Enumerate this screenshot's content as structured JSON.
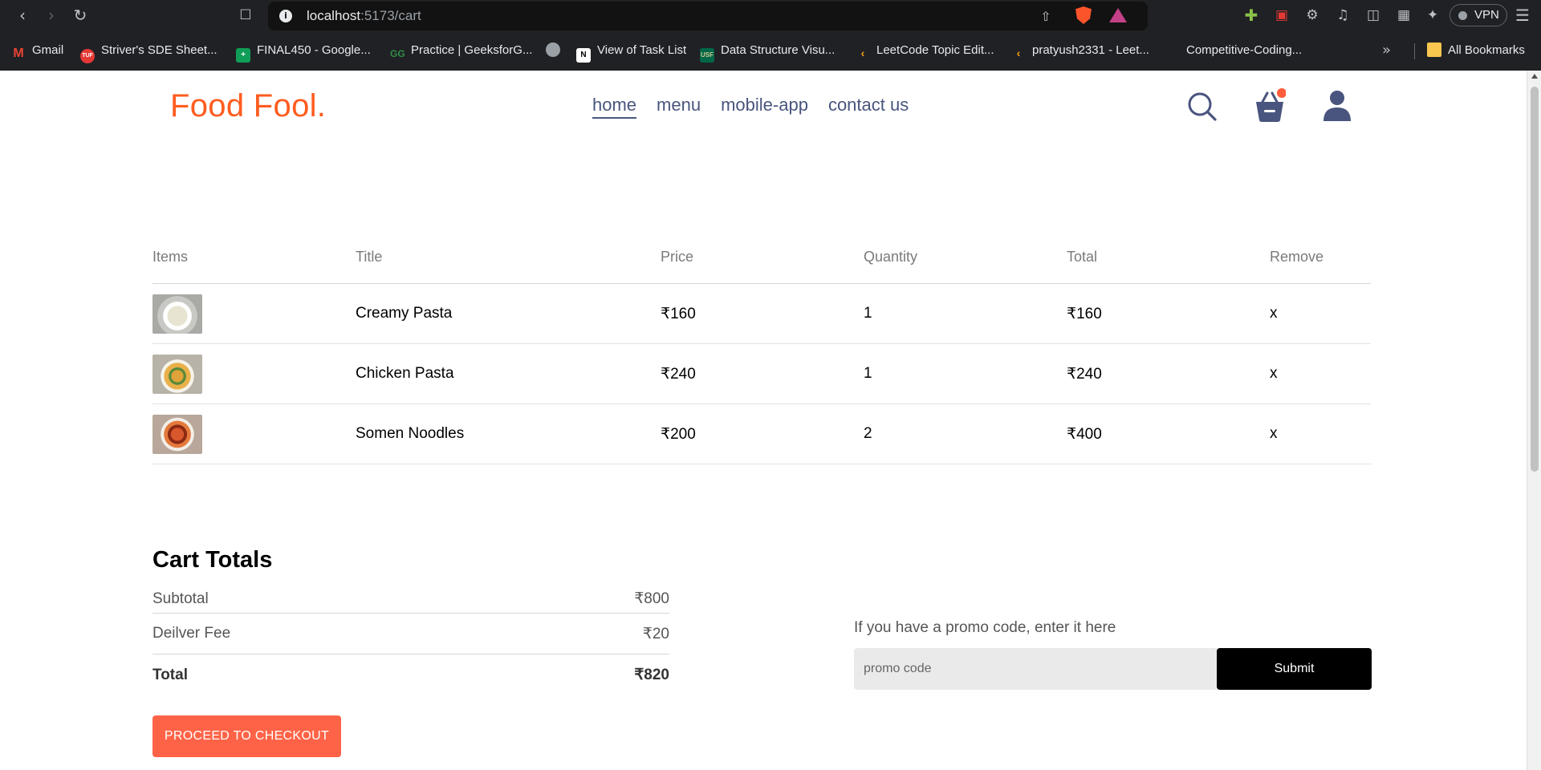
{
  "browser": {
    "url_host": "localhost",
    "url_path": ":5173/cart",
    "vpn_label": "VPN",
    "bookmarks": [
      {
        "label": "Gmail",
        "icon": "gmail-icon",
        "color": "#ea4335"
      },
      {
        "label": "Striver's SDE Sheet...",
        "icon": "tuf-icon",
        "color": "#e53935"
      },
      {
        "label": "FINAL450 - Google...",
        "icon": "sheets-icon",
        "color": "#0f9d58"
      },
      {
        "label": "Practice | GeeksforG...",
        "icon": "gfg-icon",
        "color": "#2f8d46"
      },
      {
        "label": "",
        "icon": "globe-icon",
        "color": "#9aa0a6"
      },
      {
        "label": "View of Task List",
        "icon": "notion-icon",
        "color": "#ffffff"
      },
      {
        "label": "Data Structure Visu...",
        "icon": "usf-icon",
        "color": "#006747"
      },
      {
        "label": "LeetCode Topic Edit...",
        "icon": "leetcode-icon",
        "color": "#ffa116"
      },
      {
        "label": "pratyush2331 - Leet...",
        "icon": "leetcode-icon",
        "color": "#ffa116"
      },
      {
        "label": "Competitive-Coding...",
        "icon": "",
        "color": ""
      },
      {
        "label": "All Bookmarks",
        "icon": "folder-icon",
        "color": "#f9c74f"
      }
    ]
  },
  "header": {
    "logo": "Food Fool.",
    "nav": [
      "home",
      "menu",
      "mobile-app",
      "contact us"
    ],
    "active_nav": "home",
    "cart_dot_color": "#ff5c3a",
    "accent_color": "#ff5c1f",
    "nav_color": "#49557e"
  },
  "cart": {
    "headers": [
      "Items",
      "Title",
      "Price",
      "Quantity",
      "Total",
      "Remove"
    ],
    "rows": [
      {
        "title": "Creamy Pasta",
        "price": "₹160",
        "quantity": "1",
        "total": "₹160",
        "remove": "x"
      },
      {
        "title": "Chicken Pasta",
        "price": "₹240",
        "quantity": "1",
        "total": "₹240",
        "remove": "x"
      },
      {
        "title": "Somen Noodles",
        "price": "₹200",
        "quantity": "2",
        "total": "₹400",
        "remove": "x"
      }
    ]
  },
  "totals": {
    "heading": "Cart Totals",
    "subtotal_label": "Subtotal",
    "subtotal_value": "₹800",
    "fee_label": "Deilver Fee",
    "fee_value": "₹20",
    "total_label": "Total",
    "total_value": "₹820",
    "checkout_label": "PROCEED TO CHECKOUT",
    "checkout_color": "#ff6347"
  },
  "promo": {
    "prompt": "If you have a promo code, enter it here",
    "placeholder": "promo code",
    "submit_label": "Submit"
  }
}
